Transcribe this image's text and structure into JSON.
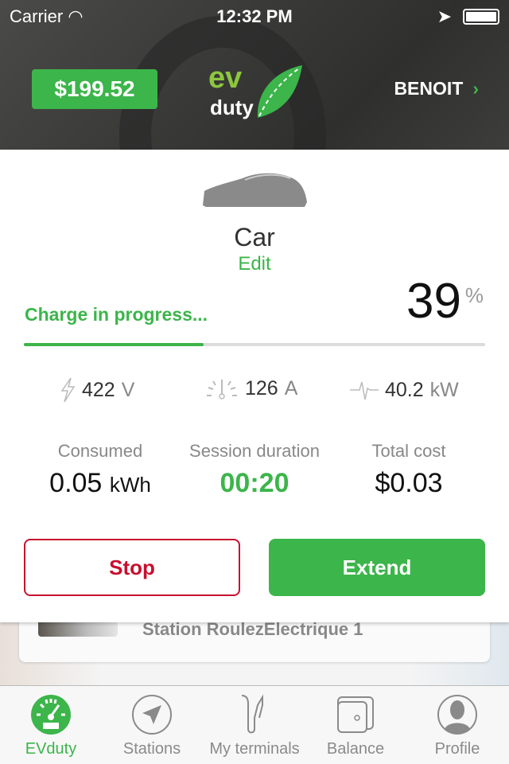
{
  "status_bar": {
    "carrier": "Carrier",
    "time": "12:32 PM"
  },
  "header": {
    "balance": "$199.52",
    "logo_text": "ev duty",
    "user": "BENOIT",
    "accent": "#3cb54a"
  },
  "vehicle": {
    "name": "Car",
    "edit_label": "Edit"
  },
  "charge": {
    "status": "Charge in progress...",
    "percent": "39",
    "percent_sign": "%",
    "progress_fraction": 0.39
  },
  "metrics": [
    {
      "icon": "lightning-icon",
      "value": "422",
      "unit": "V"
    },
    {
      "icon": "gauge-icon",
      "value": "126",
      "unit": "A"
    },
    {
      "icon": "pulse-icon",
      "value": "40.2",
      "unit": "kW"
    }
  ],
  "stats": [
    {
      "label": "Consumed",
      "value": "0.05",
      "unit": "kWh"
    },
    {
      "label": "Session duration",
      "value": "00:20"
    },
    {
      "label": "Total cost",
      "value": "$0.03"
    }
  ],
  "actions": {
    "stop": "Stop",
    "extend": "Extend",
    "stop_color": "#c8102e"
  },
  "station": {
    "name": "Station RoulezElectrique 1"
  },
  "tabs": [
    {
      "label": "EVduty",
      "icon": "speedometer-icon",
      "active": true
    },
    {
      "label": "Stations",
      "icon": "navigation-icon"
    },
    {
      "label": "My terminals",
      "icon": "charger-plug-icon"
    },
    {
      "label": "Balance",
      "icon": "wallet-icon"
    },
    {
      "label": "Profile",
      "icon": "profile-icon"
    }
  ]
}
